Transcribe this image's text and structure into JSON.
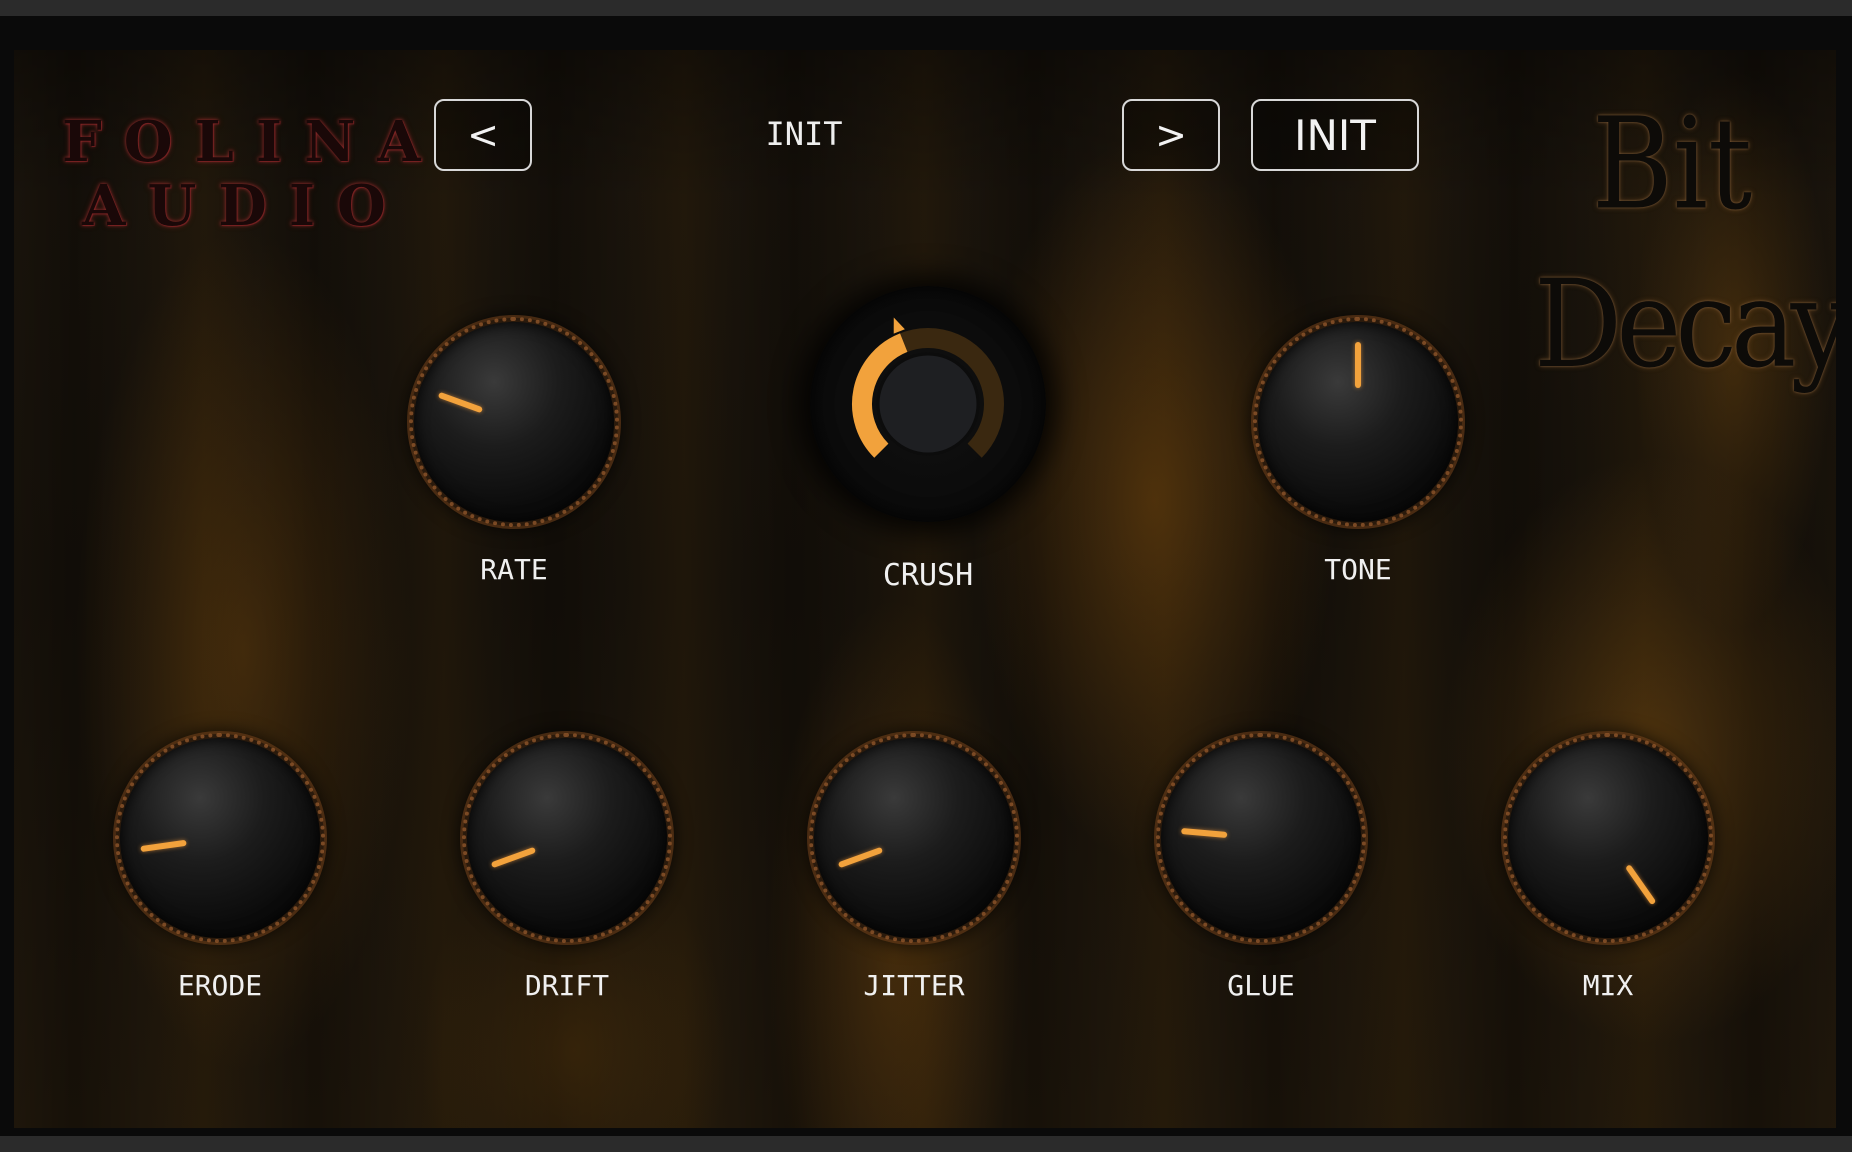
{
  "brand": {
    "line1": "FOLINA",
    "line2": "AUDIO"
  },
  "preset": {
    "prev_label": "<",
    "next_label": ">",
    "current_name": "INIT",
    "init_label": "INIT"
  },
  "product": {
    "title_word1": "Bit",
    "title_word2": "Decay"
  },
  "colors": {
    "accent": "#f2a23c",
    "text": "#f0f0f0",
    "button_border": "#d8d8d8"
  },
  "knobs": {
    "rate": {
      "label": "RATE",
      "angle_deg": -70
    },
    "crush": {
      "label": "CRUSH",
      "arc_fraction": 0.42
    },
    "tone": {
      "label": "TONE",
      "angle_deg": 0
    },
    "erode": {
      "label": "ERODE",
      "angle_deg": -98
    },
    "drift": {
      "label": "DRIFT",
      "angle_deg": -110
    },
    "jitter": {
      "label": "JITTER",
      "angle_deg": -110
    },
    "glue": {
      "label": "GLUE",
      "angle_deg": -85
    },
    "mix": {
      "label": "MIX",
      "angle_deg": 145
    }
  }
}
